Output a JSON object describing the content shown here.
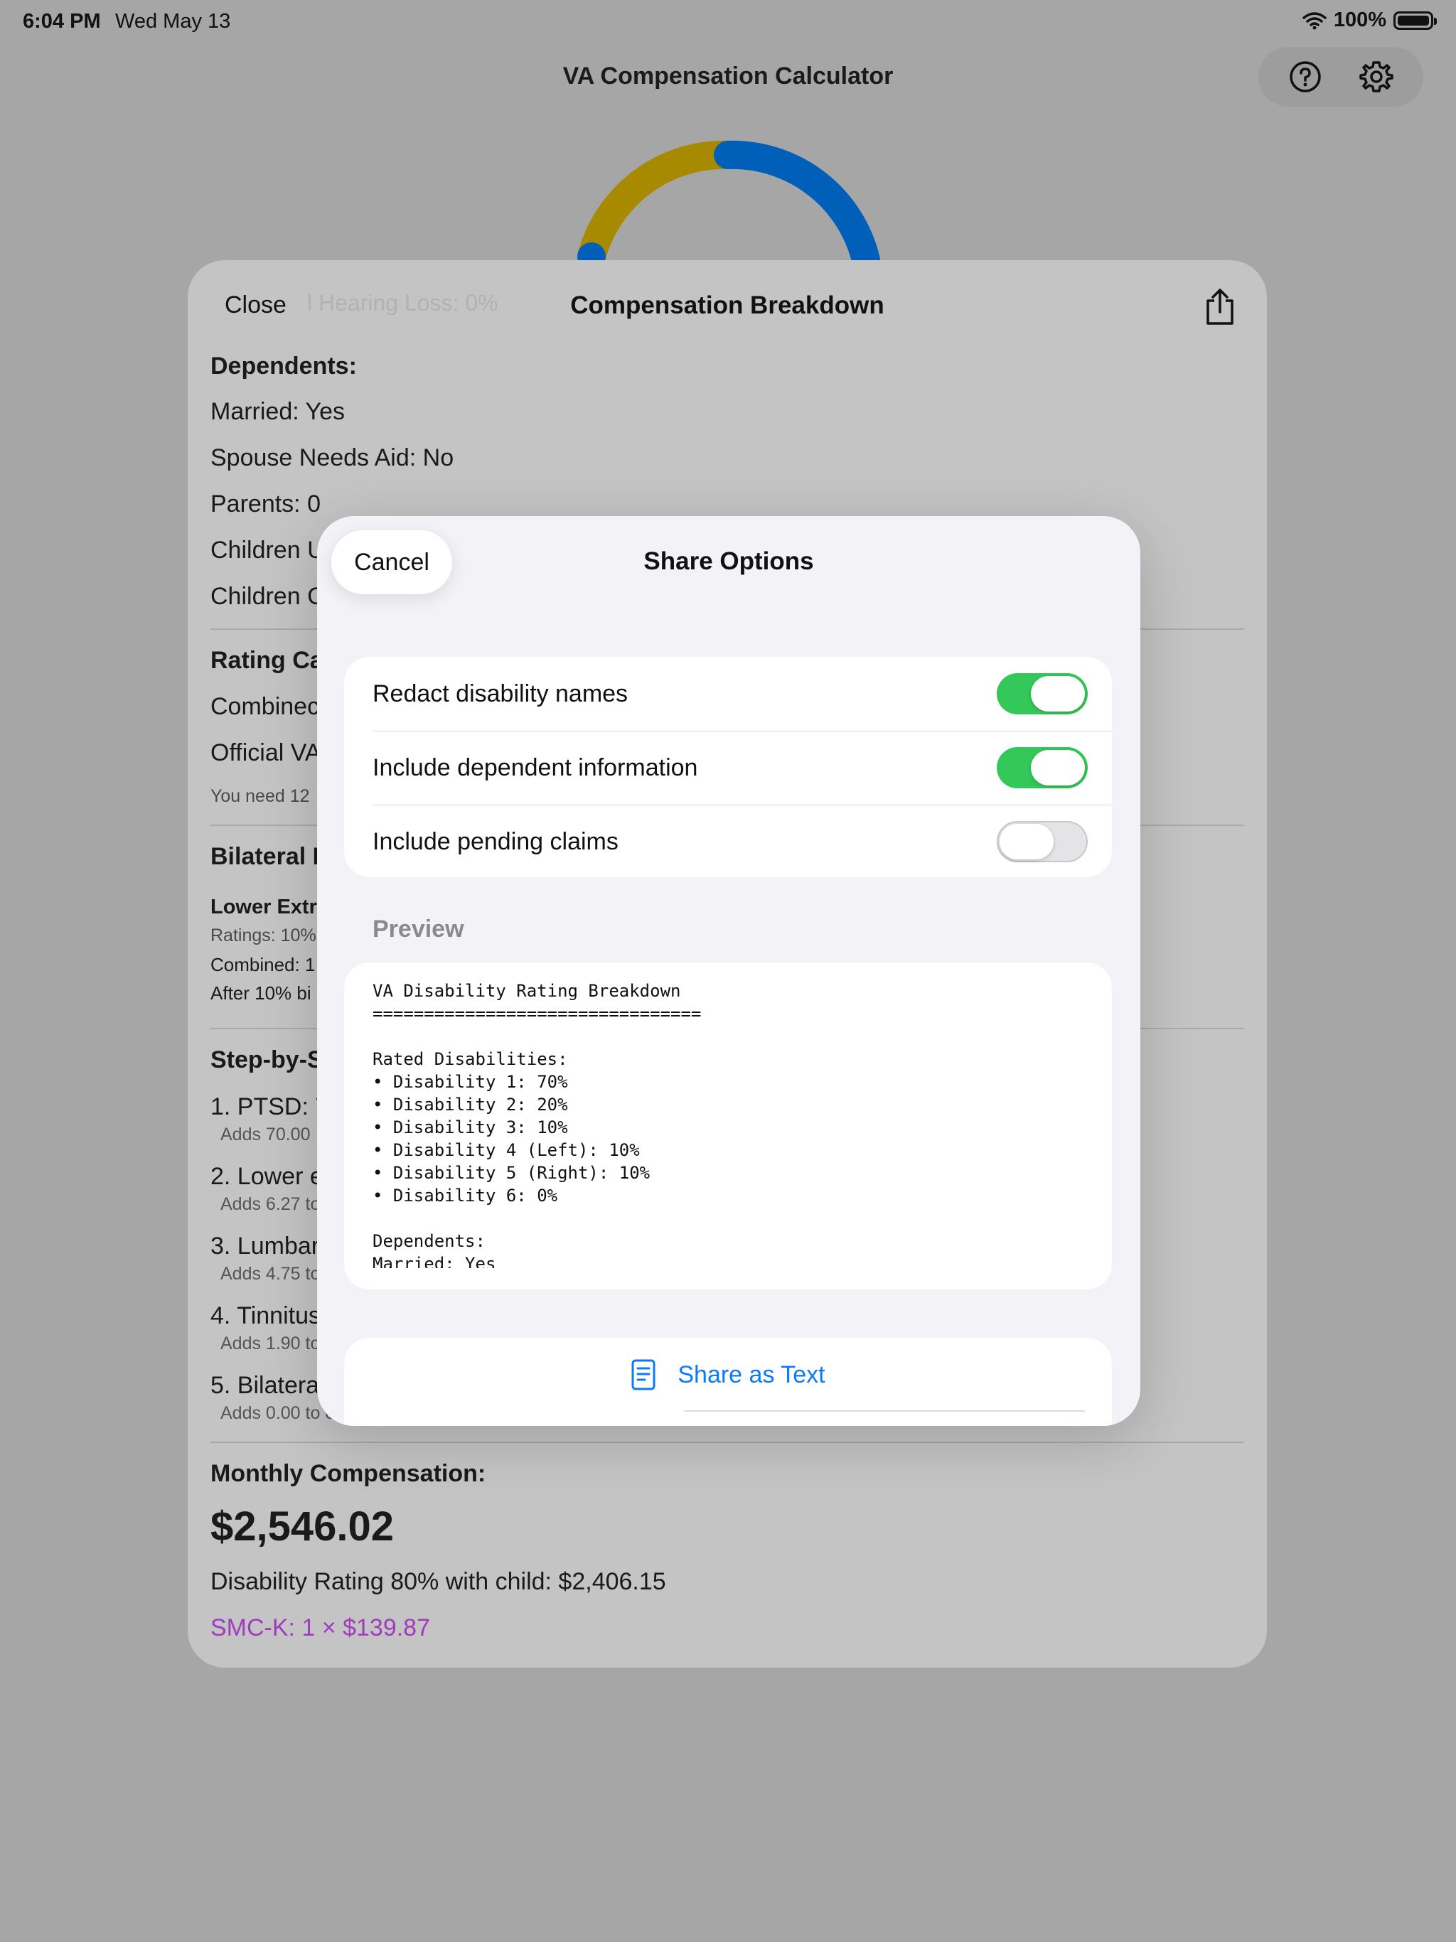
{
  "status_bar": {
    "time": "6:04 PM",
    "date": "Wed May 13",
    "battery": "100%"
  },
  "app": {
    "title": "VA Compensation Calculator"
  },
  "breakdown": {
    "close_label": "Close",
    "ghost_text": "l Hearing Loss: 0%",
    "title": "Compensation Breakdown",
    "dependents_heading": "Dependents:",
    "married": "Married: Yes",
    "spouse_aid": "Spouse Needs Aid: No",
    "parents": "Parents: 0",
    "children_under": "Children U",
    "children_over": "Children C",
    "rating_heading": "Rating Ca",
    "combined": "Combinec",
    "official": "Official VA",
    "need_note": "You need 12",
    "bilateral_heading": "Bilateral F",
    "lower_ext": "Lower Extr",
    "ratings": "Ratings: 10%",
    "combined_small": "Combined: 1",
    "after_bilateral": "After 10% bi",
    "steps_heading": "Step-by-S",
    "step1": "1. PTSD: 7",
    "step1_sub": "Adds 70.00",
    "step2": "2. Lower e",
    "step2_sub": "Adds 6.27 to",
    "step3": "3. Lumbar",
    "step3_sub": "Adds 4.75 to",
    "step4": "4. Tinnitus",
    "step4_sub": "Adds 1.90 to",
    "step5": "5. Bilatera",
    "step5_sub": "Adds 0.00 to c",
    "monthly_heading": "Monthly Compensation:",
    "monthly_amount": "$2,546.02",
    "rating_line": "Disability Rating 80% with child: $2,406.15",
    "smc_line": "SMC-K: 1 × $139.87"
  },
  "share_options": {
    "cancel_label": "Cancel",
    "title": "Share Options",
    "options": [
      {
        "label": "Redact disability names",
        "on": true
      },
      {
        "label": "Include dependent information",
        "on": true
      },
      {
        "label": "Include pending claims",
        "on": false
      }
    ],
    "preview_label": "Preview",
    "preview_text": "VA Disability Rating Breakdown\n================================\n\nRated Disabilities:\n• Disability 1: 70%\n• Disability 2: 20%\n• Disability 3: 10%\n• Disability 4 (Left): 10%\n• Disability 5 (Right): 10%\n• Disability 6: 0%\n\nDependents:\nMarried: Yes",
    "share_text_label": "Share as Text"
  },
  "colors": {
    "toggle_on": "#34c759",
    "link_blue": "#0a7aff",
    "smc_purple": "#a23bbf",
    "gauge_blue": "#005fb8",
    "gauge_gold": "#a88a00"
  }
}
